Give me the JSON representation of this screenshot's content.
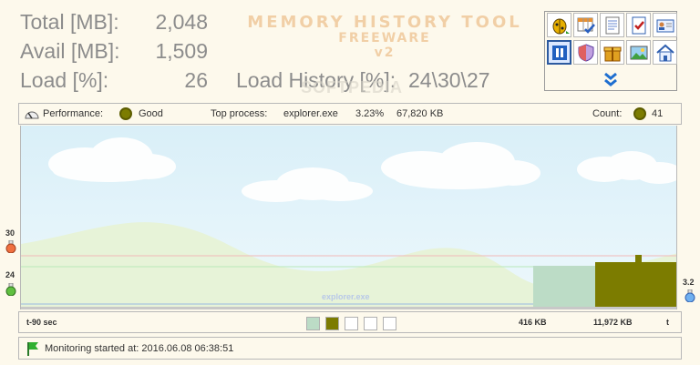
{
  "stats": {
    "total_label": "Total [MB]:",
    "total_value": "2,048",
    "avail_label": "Avail [MB]:",
    "avail_value": "1,509",
    "load_label": "Load [%]:",
    "load_value": "26",
    "history_label": "Load History [%]:",
    "history_value": "24\\30\\27"
  },
  "title": {
    "line1": "MEMORY HISTORY TOOL",
    "line2": "FREEWARE",
    "line3": "v2"
  },
  "watermark": "SOFTPEDIA",
  "toolbar": {
    "buttons": [
      {
        "icon": "bug-icon"
      },
      {
        "icon": "table-check-icon"
      },
      {
        "icon": "document-icon"
      },
      {
        "icon": "checklist-icon"
      },
      {
        "icon": "contact-card-icon"
      },
      {
        "icon": "pause-icon",
        "active": true
      },
      {
        "icon": "shield-icon"
      },
      {
        "icon": "gift-box-icon"
      },
      {
        "icon": "picture-icon"
      },
      {
        "icon": "home-icon"
      }
    ],
    "expand_icon": "double-chevron-down-icon"
  },
  "performance": {
    "label": "Performance:",
    "value": "Good",
    "top_process_label": "Top process:",
    "top_process_name": "explorer.exe",
    "top_process_percent": "3.23%",
    "top_process_memory": "67,820 KB",
    "count_label": "Count:",
    "count_value": "41",
    "indicator_color": "#7c7c00"
  },
  "graph": {
    "left_top_value": "30",
    "left_mid_value": "24",
    "right_value": "3.2",
    "process_label": "explorer.exe",
    "series_colors": {
      "primary": "#7c7c00",
      "secondary": "#bcdcc6",
      "hills": "#e7f3d8",
      "sky": "#d9eff8"
    }
  },
  "legend": {
    "time_label": "t-90 sec",
    "value1": "416 KB",
    "value2": "11,972 KB",
    "end_label": "t",
    "swatch_colors": [
      "#bcdcc6",
      "#7c7c00",
      "#ffffff",
      "#ffffff",
      "#ffffff"
    ]
  },
  "status": {
    "text": "Monitoring started at: 2016.06.08 06:38:51",
    "icon": "green-flag-icon"
  }
}
